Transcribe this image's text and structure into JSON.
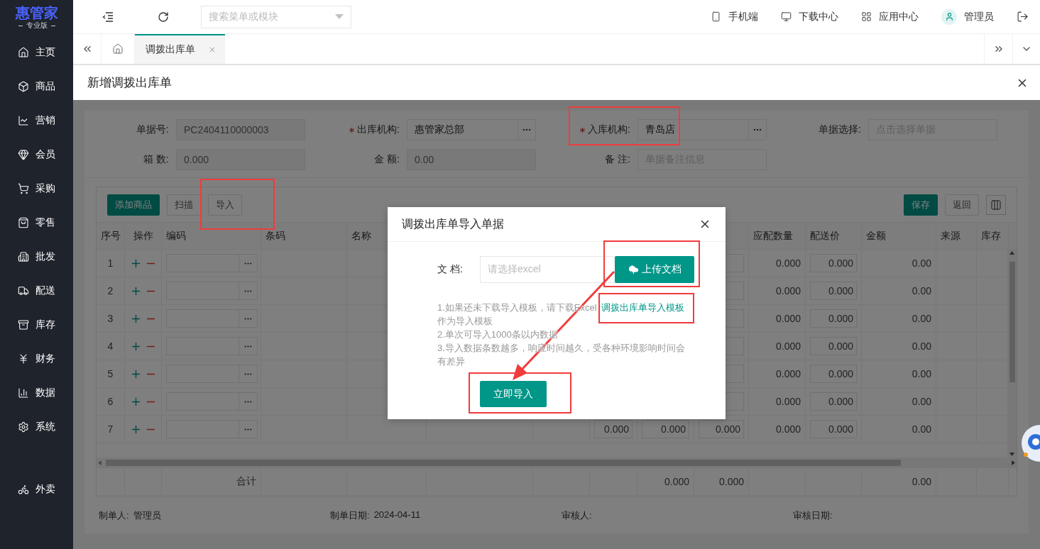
{
  "sidebar": {
    "logo": "惠管家",
    "edition": "专业版",
    "items": [
      {
        "label": "主页",
        "selected": false
      },
      {
        "label": "商品",
        "selected": false
      },
      {
        "label": "营销",
        "selected": false
      },
      {
        "label": "会员",
        "selected": false
      },
      {
        "label": "采购",
        "selected": false
      },
      {
        "label": "零售",
        "selected": false
      },
      {
        "label": "批发",
        "selected": false
      },
      {
        "label": "配送",
        "selected": false
      },
      {
        "label": "库存",
        "selected": false
      },
      {
        "label": "财务",
        "selected": false
      },
      {
        "label": "数据",
        "selected": false
      },
      {
        "label": "系统",
        "selected": false
      }
    ],
    "bottom_items": [
      {
        "label": "外卖",
        "selected": false
      }
    ]
  },
  "topbar": {
    "search": {
      "placeholder": "搜索菜单或模块"
    },
    "links": [
      "手机端",
      "下载中心",
      "应用中心"
    ],
    "user": "管理员"
  },
  "tabs": [
    {
      "label": "调拨出库单",
      "selected": true
    }
  ],
  "page_title": "新增调拨出库单",
  "form": {
    "fields": [
      {
        "label": "单据号:",
        "value": "PC2404110000003",
        "kind": "readonly",
        "required": false,
        "highlighted": false
      },
      {
        "label": "出库机构:",
        "value": "惠管家总部",
        "kind": "picker",
        "required": true,
        "highlighted": false
      },
      {
        "label": "入库机构:",
        "value": "青岛店",
        "kind": "picker",
        "required": true,
        "highlighted": true
      },
      {
        "label": "单据选择:",
        "placeholder": "点击选择单据",
        "kind": "text",
        "required": false,
        "highlighted": false
      },
      {
        "label": "箱 数:",
        "value": "0.000",
        "kind": "readonly",
        "required": false,
        "highlighted": false
      },
      {
        "label": "金 额:",
        "value": "0.00",
        "kind": "readonly",
        "required": false,
        "highlighted": false
      },
      {
        "label": "备 注:",
        "placeholder": "单据备注信息",
        "kind": "text",
        "required": false,
        "highlighted": false
      }
    ]
  },
  "toolbar": {
    "left": [
      {
        "label": "添加商品",
        "kind": "primary",
        "highlighted": false
      },
      {
        "label": "扫描",
        "kind": "default",
        "highlighted": false
      },
      {
        "label": "导入",
        "kind": "default",
        "highlighted": true
      }
    ],
    "right": [
      {
        "label": "保存",
        "kind": "primary",
        "highlighted": false
      },
      {
        "label": "返回",
        "kind": "default",
        "highlighted": false
      }
    ]
  },
  "table": {
    "columns_left": [
      "序号",
      "操作",
      "编码",
      "条码",
      "名称"
    ],
    "columns_right": [
      "应配数量",
      "配送价",
      "金额",
      "来源",
      "库存"
    ],
    "rows": [
      {
        "no": "1",
        "required_qty": "0.000",
        "price": "0.000",
        "amount": "0.00"
      },
      {
        "no": "2",
        "required_qty": "0.000",
        "price": "0.000",
        "amount": "0.00"
      },
      {
        "no": "3",
        "required_qty": "0.000",
        "price": "0.000",
        "amount": "0.00"
      },
      {
        "no": "4",
        "required_qty": "0.000",
        "price": "0.000",
        "amount": "0.00"
      },
      {
        "no": "5",
        "required_qty": "0.000",
        "price": "0.000",
        "amount": "0.00"
      },
      {
        "no": "6",
        "required_qty": "0.000",
        "price": "0.000",
        "amount": "0.00"
      },
      {
        "no": "7",
        "column_8": "0.000",
        "column_9": "0.000",
        "column_10": "0.000",
        "required_qty": "0.000",
        "price": "0.000",
        "amount": "0.00"
      }
    ],
    "totals": {
      "label": "合计",
      "column_9": "0.000",
      "column_10": "0.000",
      "amount": "0.00"
    }
  },
  "footer": [
    {
      "label": "制单人:",
      "value": "管理员"
    },
    {
      "label": "制单日期:",
      "value": "2024-04-11"
    },
    {
      "label": "审核人:"
    },
    {
      "label": "审核日期:"
    }
  ],
  "modal": {
    "title": "调拨出库单导入单据",
    "file_label": "文 档:",
    "file_placeholder": "请选择excel",
    "upload_button": {
      "label": "上传文档",
      "highlighted": true
    },
    "notes": [
      {
        "text": "1.如果还未下载导入模板，请下载Excel",
        "link": {
          "label": "调拨出库单导入模板",
          "highlighted": true
        },
        "text_after": "作为导入模板"
      },
      {
        "text": "2.单次可导入1000条以内数据"
      },
      {
        "text": "3.导入数据条数越多，响应时间越久，受各种环境影响时间会有差异"
      }
    ],
    "submit": {
      "label": "立即导入",
      "highlighted": true
    }
  }
}
